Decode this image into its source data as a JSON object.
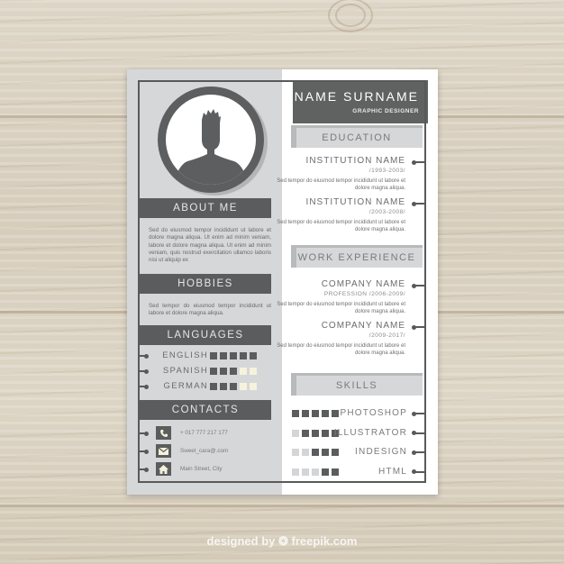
{
  "header": {
    "name": "NAME SURNAME",
    "role": "GRAPHIC DESIGNER"
  },
  "left": {
    "about": {
      "title": "ABOUT ME",
      "text": "Sed do eiusmod tempor incididunt ut labore et dolore magna aliqua. Ut enim ad minim veniam, labore et dolore magna aliqua. Ut enim ad minim veniam, quis nostrud exercitation ullamco laboris nisi ut aliquip ex"
    },
    "hobbies": {
      "title": "HOBBIES",
      "text": "Sed tempor do eiusmod tempor incididunt ut labore et dolore magna aliqua."
    },
    "languages": {
      "title": "LANGUAGES",
      "items": [
        {
          "name": "ENGLISH",
          "level": 5,
          "max": 5
        },
        {
          "name": "SPANISH",
          "level": 3,
          "max": 5
        },
        {
          "name": "GERMAN",
          "level": 3,
          "max": 5
        }
      ]
    },
    "contacts": {
      "title": "CONTACTS",
      "items": [
        {
          "icon": "phone-icon",
          "text": "+ 017 777 217 177"
        },
        {
          "icon": "mail-icon",
          "text": "Sweet_cara@.com"
        },
        {
          "icon": "home-icon",
          "text": "Main Street, City"
        }
      ]
    }
  },
  "right": {
    "education": {
      "title": "EDUCATION",
      "items": [
        {
          "title": "INSTITUTION NAME",
          "date": "/1993-2003/",
          "desc": "Sed tempor do eiusmod tempor incididunt ut labore et dolore magna aliqua."
        },
        {
          "title": "INSTITUTION NAME",
          "date": "/2003-2008/",
          "desc": "Sed tempor do eiusmod tempor incididunt ut labore et dolore magna aliqua."
        }
      ]
    },
    "work": {
      "title": "WORK EXPERIENCE",
      "items": [
        {
          "title": "COMPANY NAME",
          "date": "PROFESSION /2006-2009/",
          "desc": "Sed tempor do eiusmod tempor incididunt ut labore et dolore magna aliqua."
        },
        {
          "title": "COMPANY NAME",
          "date": "/2009-2017/",
          "desc": "Sed tempor do eiusmod tempor incididunt ut labore et dolore magna aliqua."
        }
      ]
    },
    "skills": {
      "title": "SKILLS",
      "items": [
        {
          "name": "PHOTOSHOP",
          "level": 5,
          "max": 5
        },
        {
          "name": "ILLUSTRATOR",
          "level": 4,
          "max": 5
        },
        {
          "name": "INDESIGN",
          "level": 3,
          "max": 5
        },
        {
          "name": "HTML",
          "level": 2,
          "max": 5
        }
      ]
    }
  },
  "watermark": "designed by ❂ freepik.com",
  "colors": {
    "dark": "#5b5c5d",
    "light": "#d6d7d9",
    "accent_bar": "#b7babb",
    "cream": "#f6f3dc"
  }
}
